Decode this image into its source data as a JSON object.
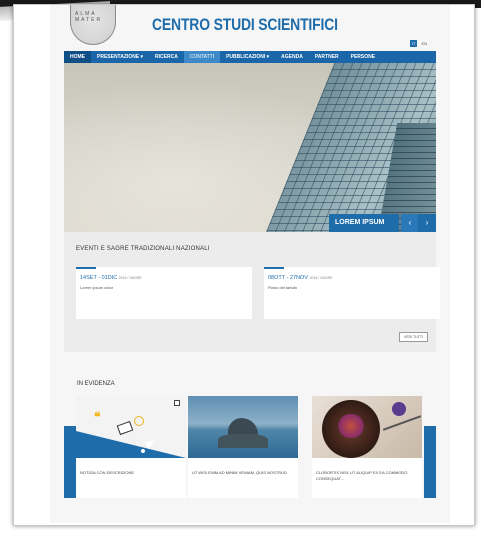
{
  "header": {
    "site_title": "CENTRO STUDI SCIENTIFICI",
    "logo_text": "ALMA MATER",
    "lang_active": "IT",
    "lang_other": "EN"
  },
  "nav": {
    "items": [
      "HOME",
      "PRESENTAZIONE ▾",
      "RICERCA",
      "CONTATTI",
      "PUBBLICAZIONI ▾",
      "AGENDA",
      "PARTNER",
      "PERSONE"
    ],
    "active": "CONTATTI"
  },
  "hero": {
    "caption": "LOREM IPSUM",
    "prev_icon": "chevron-left-icon",
    "next_icon": "chevron-right-icon",
    "prev_glyph": "‹",
    "next_glyph": "›"
  },
  "events": {
    "title": "EVENTI E SAGRE TRADIZIONALI NAZIONALI",
    "cards": [
      {
        "date": "14SET - 01DIC",
        "meta": "2016 / SAGRE",
        "desc": "Lorem ipsum dolor"
      },
      {
        "date": "08OTT - 27NOV",
        "meta": "2016 / SAGRE",
        "desc": "Piano del tartufo"
      }
    ],
    "more_label": "VEDI TUTTI"
  },
  "evidenza": {
    "title": "IN EVIDENZA",
    "cards": [
      {
        "label": "NOTIZIA CON DESCRIZIONE"
      },
      {
        "label": "UT WISI ENIM AD MINIM VENIAM, QUIS NOSTRUD"
      },
      {
        "label": "CLOBORTIS NISL UT ALIQUIP EX EA COMMODO CONSEQUAT..."
      }
    ]
  },
  "colors": {
    "brand_blue": "#1f6cab",
    "nav_dark": "#0f4f85"
  }
}
